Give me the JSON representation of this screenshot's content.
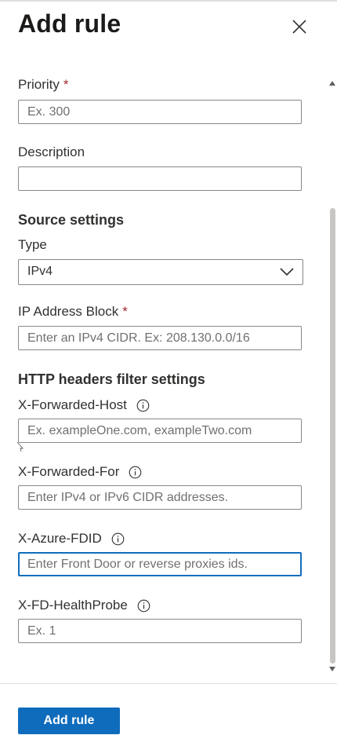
{
  "header": {
    "title": "Add rule",
    "close_icon": "close-icon"
  },
  "form": {
    "priority": {
      "label": "Priority",
      "required_mark": "*",
      "placeholder": "Ex. 300",
      "value": ""
    },
    "description": {
      "label": "Description",
      "placeholder": "",
      "value": ""
    },
    "source_settings": {
      "title": "Source settings",
      "type": {
        "label": "Type",
        "selected": "IPv4",
        "chevron_icon": "chevron-down-icon"
      },
      "ip_address_block": {
        "label": "IP Address Block",
        "required_mark": "*",
        "placeholder": "Enter an IPv4 CIDR. Ex: 208.130.0.0/16",
        "value": ""
      }
    },
    "http_headers": {
      "title": "HTTP headers filter settings",
      "x_forwarded_host": {
        "label": "X-Forwarded-Host",
        "info_icon": "info-icon",
        "placeholder": "Ex. exampleOne.com, exampleTwo.com",
        "value": ""
      },
      "x_forwarded_for": {
        "label": "X-Forwarded-For",
        "info_icon": "info-icon",
        "placeholder": "Enter IPv4 or IPv6 CIDR addresses.",
        "value": ""
      },
      "x_azure_fdid": {
        "label": "X-Azure-FDID",
        "info_icon": "info-icon",
        "placeholder": "Enter Front Door or reverse proxies ids.",
        "value": "",
        "focused": true
      },
      "x_fd_healthprobe": {
        "label": "X-FD-HealthProbe",
        "info_icon": "info-icon",
        "placeholder": "Ex. 1",
        "value": ""
      }
    }
  },
  "footer": {
    "add_rule_label": "Add rule"
  },
  "colors": {
    "accent": "#0f6cbd",
    "required": "#a4262c",
    "border": "#8a8886",
    "text": "#323130"
  }
}
